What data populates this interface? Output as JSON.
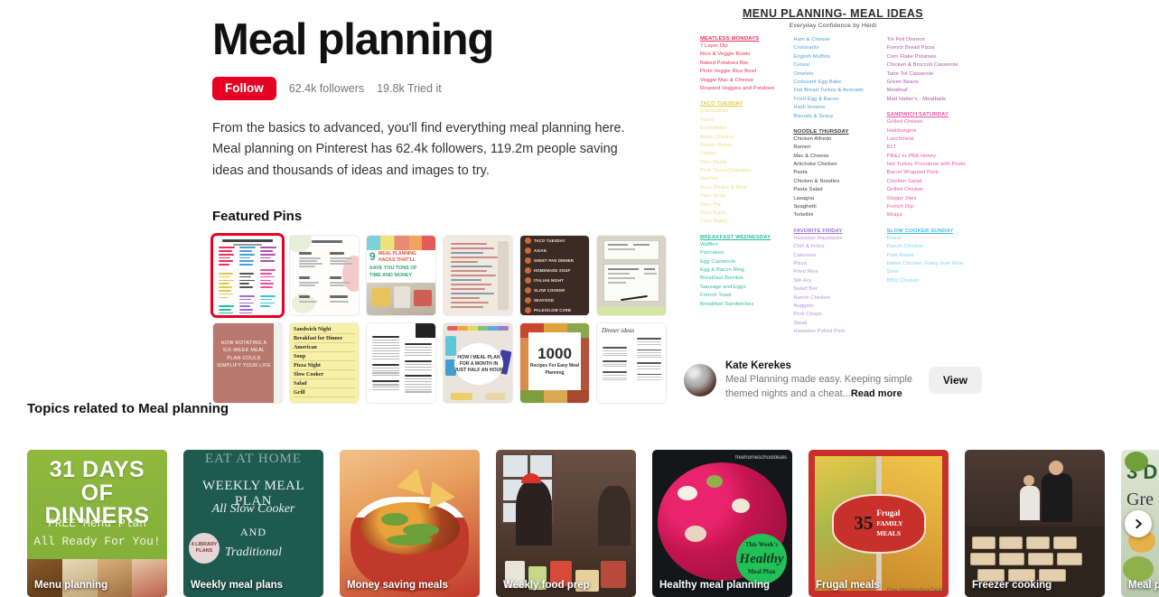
{
  "header": {
    "title": "Meal planning",
    "follow_label": "Follow",
    "followers": "62.4k followers",
    "tried_it": "19.8k Tried it",
    "description": "From the basics to advanced, you'll find everything meal planning here. Meal planning on Pinterest has 62.4k followers, 119.2m people saving ideas and thousands of ideas and images to try.",
    "accent_color": "#e60023"
  },
  "featured": {
    "section_title": "Featured Pins",
    "pins": [
      {
        "name": "menu-planning-meal-ideas-chart",
        "selected": true
      },
      {
        "name": "recipe-menu-two-column",
        "selected": false
      },
      {
        "name": "9-meal-planning-hacks",
        "selected": false
      },
      {
        "name": "handwritten-meal-planner",
        "selected": false
      },
      {
        "name": "themed-nights-dark-list",
        "selected": false
      },
      {
        "name": "whiteboard-meal-board",
        "selected": false
      },
      {
        "name": "six-week-rotating-meal-plan",
        "selected": false
      },
      {
        "name": "sandwich-night-yellow-list",
        "selected": false
      },
      {
        "name": "printable-grocery-list",
        "selected": false
      },
      {
        "name": "meal-plan-month-half-hour",
        "selected": false
      },
      {
        "name": "1000-recipes-easy-meal-planning",
        "selected": false
      },
      {
        "name": "dinner-ideas-printable",
        "selected": false
      }
    ],
    "pin_texts": {
      "hacks_num": "9",
      "hacks_l1": "MEAL PLANNING",
      "hacks_l2": "HACKS THAT'LL",
      "hacks_l3": "SAVE YOU TONS OF",
      "hacks_l4": "TIME AND MONEY",
      "dark_items": [
        "TACO TUESDAY",
        "ASIAN",
        "SHEET PAN DINNER",
        "HOMEMADE SOUP",
        "ITALIAN NIGHT",
        "SLOW COOKER",
        "SEAFOOD",
        "PALEO/LOW CARB"
      ],
      "book_text": "HOW ROTATING A SIX-WEEK MEAL PLAN COULD SIMPLIFY YOUR LIFE",
      "yellow_items": [
        "Sandwich Night",
        "Breakfast for Dinner",
        "American",
        "Soup",
        "Pizza Night",
        "Slow Cooker",
        "Salad",
        "Grill"
      ],
      "circle_text": "HOW I MEAL PLAN FOR A MONTH IN JUST HALF AN HOUR",
      "collage_big": "1000",
      "collage_small": "Recipes For Easy Meal Planning",
      "dinner_script": "Dinner ideas"
    }
  },
  "preview": {
    "title": "MENU PLANNING- MEAL IDEAS",
    "subtitle": "Everyday Confidence by Heidi",
    "columns": [
      {
        "groups": [
          {
            "heading": "MEATLESS MONDAYS",
            "color": "#e8305a",
            "items": [
              "7 Layer Dip",
              "Rice & Veggie Bowls",
              "Baked Potatoes Bar",
              "Pinto Veggie Rice Bowl",
              "Veggie Mac & Cheese",
              "Roasted Veggies and Potatoes"
            ]
          },
          {
            "heading": "TACO TUESDAY",
            "color": "#f0d24a",
            "items": [
              "Quesadillas",
              "Tacos",
              "Enchiladas",
              "Aztec Chicken",
              "Burrito Bowls",
              "Fajitas",
              "Taco Pasta",
              "Pork Tacos/Chalupas",
              "Nachos",
              "Rice, Beans & Rice",
              "Taco Soup",
              "Taco Pie",
              "Taco Pizza",
              "Taco Salad"
            ]
          },
          {
            "heading": "BREAKFAST WEDNESDAY",
            "color": "#2bbd9a",
            "items": [
              "Waffles",
              "Pancakes",
              "Egg Casserole",
              "Egg & Bacon Ring",
              "Breakfast Burritos",
              "Sausage and Eggs",
              "French Toast",
              "Breakfast Sandwiches"
            ]
          }
        ]
      },
      {
        "groups": [
          {
            "heading": "",
            "color": "#4a9ed8",
            "items": [
              "Ham & Cheese",
              "Croissants",
              "English Muffins",
              "Cereal",
              "Omelets",
              "Croissant Egg Bake",
              "Flat Bread Turkey & Avocado",
              "Fried Egg & Bacon",
              "Hash browns",
              "Biscuits & Gravy"
            ]
          },
          {
            "heading": "NOODLE THURSDAY",
            "color": "#3a3a3a",
            "items": [
              "Chicken Alfredo",
              "Ramen",
              "Mac & Cheese",
              "Artichoke Chicken",
              "Pasta",
              "Chicken & Noodles",
              "Pasta Salad",
              "Lasagna",
              "Spaghetti",
              "Tortellini"
            ]
          },
          {
            "heading": "FAVORITE FRIDAY",
            "color": "#9b6fd0",
            "items": [
              "Hawaiian Haystacks",
              "Chili & Fritos",
              "Calzones",
              "Pizza",
              "Fried Rice",
              "Stir-Fry",
              "Salad Bar",
              "Ranch Chicken",
              "Nuggets",
              "Pork Chops",
              "Steak",
              "Hawaiian Pulled Pork"
            ]
          }
        ]
      },
      {
        "groups": [
          {
            "heading": "",
            "color": "#b050a8",
            "items": [
              "Tin Foil Dinners",
              "French Bread Pizza",
              "Corn Flake Potatoes",
              "Chicken & Broccoli Casserole",
              "Tator Tot Casserole",
              "Green Beans",
              "Meatloaf",
              "Mad Hatter'n - Meatballs"
            ]
          },
          {
            "heading": "SANDWICH SATURDAY",
            "color": "#ec4fa0",
            "items": [
              "Grilled Cheese",
              "Hamburgers",
              "Lunchmeat",
              "BLT",
              "PB&J or PB& Honey",
              "Hot Turkey Provolone with Pesto",
              "Bacon Wrapped Pork",
              "Chicken Salad",
              "Grilled Chicken",
              "Sloppy Joes",
              "French Dip",
              "Wraps"
            ]
          },
          {
            "heading": "SLOW COOKER SUNDAY",
            "color": "#3fc0e8",
            "items": [
              "Roast",
              "Ranch Chicken",
              "Pork Roast",
              "Italian Chicken Gravy over Rice",
              "Stew",
              "BBQ Chicken"
            ]
          }
        ]
      }
    ]
  },
  "author": {
    "name": "Kate Kerekes",
    "description": "Meal Planning made easy. Keeping simple themed nights and a cheat...",
    "read_more": "Read more",
    "view_label": "View"
  },
  "topics": {
    "section_title": "Topics related to Meal planning",
    "next_icon": "chevron-right-icon",
    "cards": [
      {
        "label": "Menu planning",
        "art": "31days",
        "t1": "31 DAYS",
        "t2": "OF DINNERS",
        "t3": "FREE Menu Plan",
        "t4": "All Ready For You!"
      },
      {
        "label": "Weekly meal plans",
        "art": "chalk",
        "t1": "EAT AT HOME",
        "t2": "WEEKLY MEAL PLAN",
        "t3": "All Slow Cooker",
        "t4": "AND",
        "t5": "Traditional",
        "badge": "4 LIBRARY PLANS"
      },
      {
        "label": "Money saving meals",
        "art": "chili"
      },
      {
        "label": "Weekly food prep",
        "art": "prep"
      },
      {
        "label": "Healthy meal planning",
        "art": "healthy",
        "t1": "This Week's",
        "t2": "Healthy",
        "t3": "Meal Plan",
        "wm": "freehomeschooldeals"
      },
      {
        "label": "Frugal meals",
        "art": "frugal",
        "t1": "35",
        "t2": "Frugal",
        "t3": "FAMILY",
        "t4": "MEALS",
        "wm": "Free Homeschool Deals"
      },
      {
        "label": "Freezer cooking",
        "art": "freezer"
      },
      {
        "label": "Meal p",
        "art": "mealp",
        "t1": "3 D",
        "t2": "Gre"
      }
    ]
  }
}
